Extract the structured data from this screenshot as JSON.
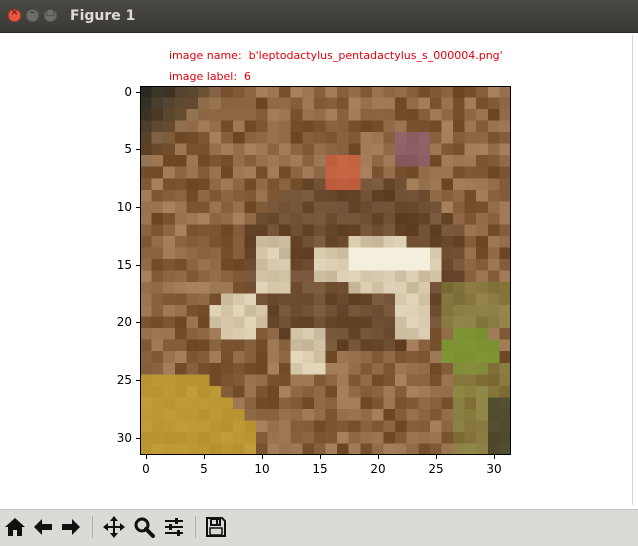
{
  "window": {
    "title": "Figure 1"
  },
  "annotations": {
    "image_name": "image name:  b'leptodactylus_pentadactylus_s_000004.png'",
    "image_label": "image label:  6"
  },
  "axes": {
    "y_ticks": [
      "0",
      "5",
      "10",
      "15",
      "20",
      "25",
      "30"
    ],
    "x_ticks": [
      "0",
      "5",
      "10",
      "15",
      "20",
      "25",
      "30"
    ],
    "y_tick_values": [
      0,
      5,
      10,
      15,
      20,
      25,
      30
    ],
    "x_tick_values": [
      0,
      5,
      10,
      15,
      20,
      25,
      30
    ],
    "xlim": [
      -0.5,
      31.5
    ],
    "ylim": [
      31.5,
      -0.5
    ]
  },
  "image": {
    "grid_size": 32,
    "base_color": "#8a6440",
    "regions": [
      {
        "name": "dark-corner",
        "color": "#2a2a22"
      },
      {
        "name": "orange-eye",
        "color": "#d06040"
      },
      {
        "name": "purple-spot",
        "color": "#8a5a70"
      },
      {
        "name": "frog-dark",
        "color": "#4a2e1c"
      },
      {
        "name": "frog-light",
        "color": "#e8dcc0"
      },
      {
        "name": "frog-white",
        "color": "#f4eedc"
      },
      {
        "name": "yellow-leaf",
        "color": "#c8a430"
      },
      {
        "name": "green-leaf",
        "color": "#7a9a30"
      },
      {
        "name": "olive-leaf",
        "color": "#8a8a40"
      }
    ]
  },
  "toolbar": {
    "buttons": [
      {
        "name": "home-button",
        "icon": "home-icon"
      },
      {
        "name": "back-button",
        "icon": "arrow-left-icon"
      },
      {
        "name": "forward-button",
        "icon": "arrow-right-icon"
      },
      {
        "name": "pan-button",
        "icon": "move-icon"
      },
      {
        "name": "zoom-button",
        "icon": "magnifier-icon"
      },
      {
        "name": "configure-subplots-button",
        "icon": "sliders-icon"
      },
      {
        "name": "save-button",
        "icon": "floppy-disk-icon"
      }
    ]
  }
}
